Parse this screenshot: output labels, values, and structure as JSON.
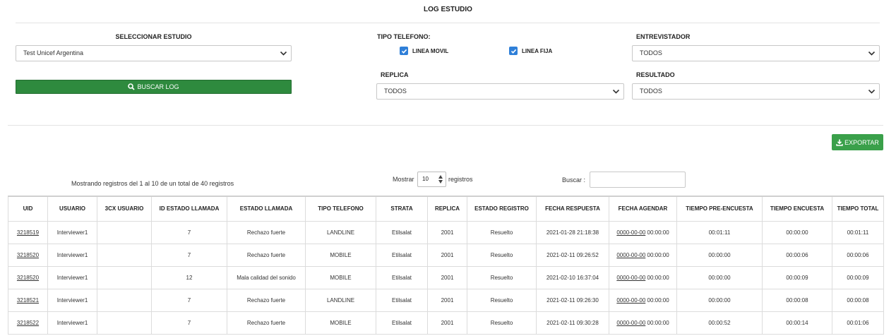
{
  "page": {
    "title": "LOG ESTUDIO"
  },
  "filters": {
    "study": {
      "label": "SELECCIONAR ESTUDIO",
      "value": "Test Unicef Argentina"
    },
    "phone_type": {
      "label": "TIPO TELEFONO:",
      "options": [
        {
          "label": "LINEA MOVIL",
          "checked": true
        },
        {
          "label": "LINEA FIJA",
          "checked": true
        }
      ]
    },
    "interviewer": {
      "label": "ENTREVISTADOR",
      "value": "TODOS"
    },
    "replica": {
      "label": "REPLICA",
      "value": "TODOS"
    },
    "result": {
      "label": "RESULTADO",
      "value": "TODOS"
    },
    "search_button": {
      "label": "BUSCAR LOG",
      "icon": "search-icon"
    }
  },
  "export_button": {
    "label": "EXPORTAR",
    "icon": "download-icon"
  },
  "table_controls": {
    "summary": "Mostrando registros del 1 al 10 de un total de 40 registros",
    "show_label": "Mostrar",
    "show_value": "10",
    "records_label": "registros",
    "search_label": "Buscar :",
    "search_value": ""
  },
  "table": {
    "columns": [
      "UID",
      "USUARIO",
      "3CX USUARIO",
      "ID ESTADO LLAMADA",
      "ESTADO LLAMADA",
      "TIPO TELEFONO",
      "STRATA",
      "REPLICA",
      "ESTADO REGISTRO",
      "FECHA RESPUESTA",
      "FECHA AGENDAR",
      "TIEMPO PRE-ENCUESTA",
      "TIEMPO ENCUESTA",
      "TIEMPO TOTAL"
    ],
    "rows": [
      {
        "uid": "3218519",
        "usuario": "Interviewer1",
        "cx_usuario": "",
        "id_estado": "7",
        "estado_llamada": "Rechazo fuerte",
        "tipo_telefono": "LANDLINE",
        "strata": "Etilsalat",
        "replica": "2001",
        "estado_registro": "Resuelto",
        "fecha_respuesta": "2021-01-28 21:18:38",
        "fecha_agendar_date": "0000-00-00",
        "fecha_agendar_time": "00:00:00",
        "tiempo_pre": "00:01:11",
        "tiempo_encuesta": "00:00:00",
        "tiempo_total": "00:01:11"
      },
      {
        "uid": "3218520",
        "usuario": "Interviewer1",
        "cx_usuario": "",
        "id_estado": "7",
        "estado_llamada": "Rechazo fuerte",
        "tipo_telefono": "MOBILE",
        "strata": "Etilsalat",
        "replica": "2001",
        "estado_registro": "Resuelto",
        "fecha_respuesta": "2021-02-11 09:26:52",
        "fecha_agendar_date": "0000-00-00",
        "fecha_agendar_time": "00:00:00",
        "tiempo_pre": "00:00:00",
        "tiempo_encuesta": "00:00:06",
        "tiempo_total": "00:00:06"
      },
      {
        "uid": "3218520",
        "usuario": "Interviewer1",
        "cx_usuario": "",
        "id_estado": "12",
        "estado_llamada": "Mala calidad del sonido",
        "tipo_telefono": "MOBILE",
        "strata": "Etilsalat",
        "replica": "2001",
        "estado_registro": "Resuelto",
        "fecha_respuesta": "2021-02-10 16:37:04",
        "fecha_agendar_date": "0000-00-00",
        "fecha_agendar_time": "00:00:00",
        "tiempo_pre": "00:00:00",
        "tiempo_encuesta": "00:00:09",
        "tiempo_total": "00:00:09"
      },
      {
        "uid": "3218521",
        "usuario": "Interviewer1",
        "cx_usuario": "",
        "id_estado": "7",
        "estado_llamada": "Rechazo fuerte",
        "tipo_telefono": "LANDLINE",
        "strata": "Etilsalat",
        "replica": "2001",
        "estado_registro": "Resuelto",
        "fecha_respuesta": "2021-02-11 09:26:30",
        "fecha_agendar_date": "0000-00-00",
        "fecha_agendar_time": "00:00:00",
        "tiempo_pre": "00:00:00",
        "tiempo_encuesta": "00:00:08",
        "tiempo_total": "00:00:08"
      },
      {
        "uid": "3218522",
        "usuario": "Interviewer1",
        "cx_usuario": "",
        "id_estado": "7",
        "estado_llamada": "Rechazo fuerte",
        "tipo_telefono": "MOBILE",
        "strata": "Etilsalat",
        "replica": "2001",
        "estado_registro": "Resuelto",
        "fecha_respuesta": "2021-02-11 09:30:28",
        "fecha_agendar_date": "0000-00-00",
        "fecha_agendar_time": "00:00:00",
        "tiempo_pre": "00:00:52",
        "tiempo_encuesta": "00:00:14",
        "tiempo_total": "00:01:06"
      }
    ]
  }
}
